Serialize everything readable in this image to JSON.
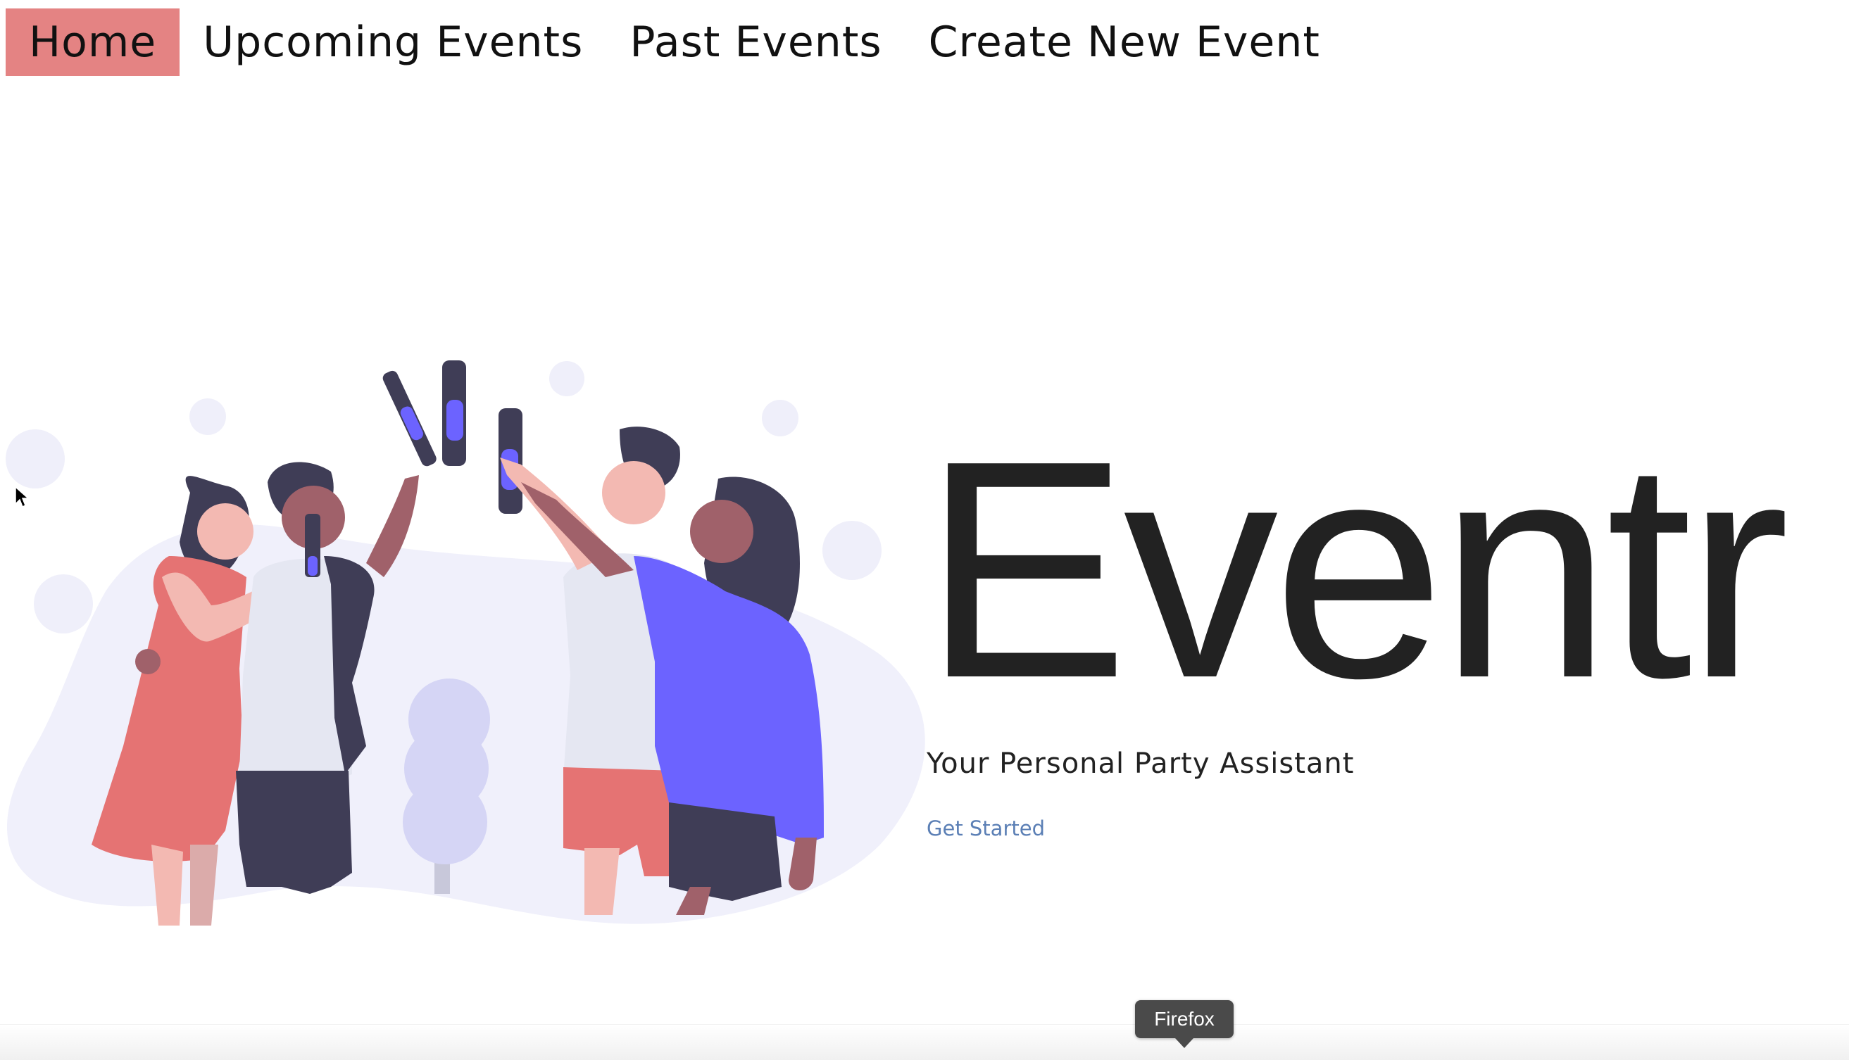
{
  "nav": {
    "items": [
      {
        "label": "Home",
        "active": true
      },
      {
        "label": "Upcoming Events",
        "active": false
      },
      {
        "label": "Past Events",
        "active": false
      },
      {
        "label": "Create New Event",
        "active": false
      }
    ]
  },
  "hero": {
    "title": "Eventr",
    "subtitle": "Your Personal Party Assistant",
    "cta_label": "Get Started"
  },
  "dock": {
    "tooltip": "Firefox"
  },
  "illustration": {
    "icon": "people-celebrating-illustration"
  },
  "colors": {
    "nav_active_bg": "#e48383",
    "title": "#222222",
    "link": "#5b7fb5",
    "accent_purple": "#6c63ff",
    "accent_red": "#e57373",
    "dark": "#3f3d56",
    "blob": "#f0f0fb"
  }
}
